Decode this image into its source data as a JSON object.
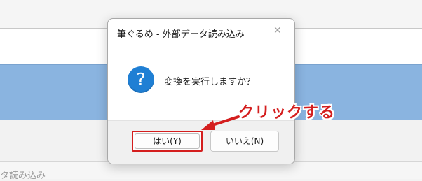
{
  "background": {
    "footer_text": "タ読み込み"
  },
  "dialog": {
    "title": "筆ぐるめ - 外部データ読み込み",
    "close_glyph": "✕",
    "icon_glyph": "?",
    "message": "変換を実行しますか？",
    "yes_label": "はい(Y)",
    "no_label": "いいえ(N)"
  },
  "annotation": {
    "text": "クリックする",
    "color": "#d41e1e"
  }
}
